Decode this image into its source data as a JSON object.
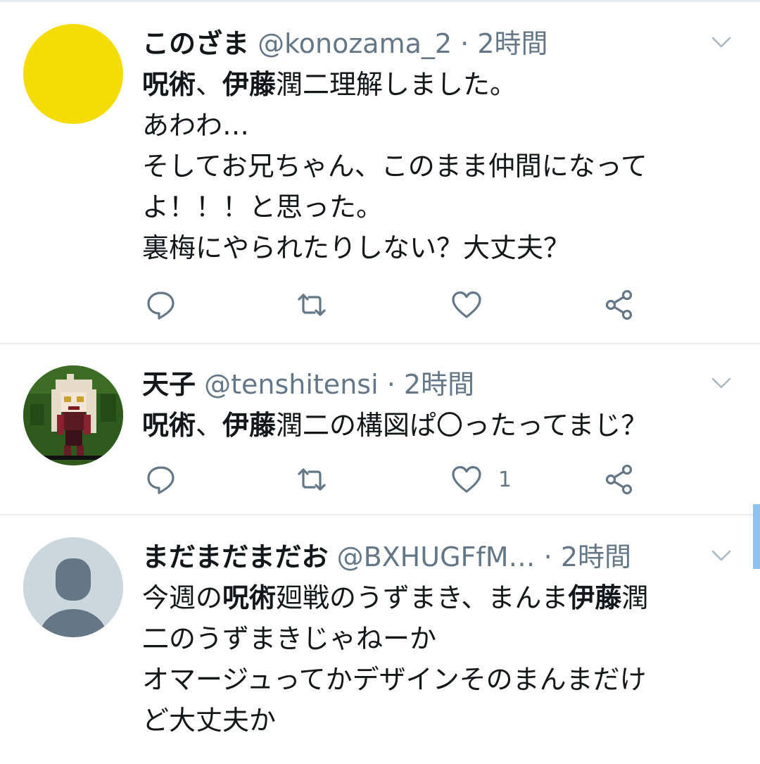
{
  "tweets": [
    {
      "user": {
        "name": "このざま",
        "handle": "@konozama_2"
      },
      "separator": "·",
      "time": "2時間",
      "lines": [
        [
          {
            "t": "呪術",
            "b": true
          },
          {
            "t": "、"
          },
          {
            "t": "伊藤",
            "b": true
          },
          {
            "t": "潤二理解しました。"
          }
        ],
        [
          {
            "t": "あわわ…"
          }
        ],
        [
          {
            "t": "そしてお兄ちゃん、このまま仲間になって"
          }
        ],
        [
          {
            "t": "よ！！！と思った。"
          }
        ],
        [
          {
            "t": "裏梅にやられたりしない？大丈夫？"
          }
        ]
      ],
      "like_count": ""
    },
    {
      "user": {
        "name": "天子",
        "handle": "@tenshitensi"
      },
      "separator": "·",
      "time": "2時間",
      "lines": [
        [
          {
            "t": "呪術",
            "b": true
          },
          {
            "t": "、"
          },
          {
            "t": "伊藤",
            "b": true
          },
          {
            "t": "潤二の構図ぱ〇ったってまじ？"
          }
        ]
      ],
      "like_count": "1"
    },
    {
      "user": {
        "name": "まだまだまだお",
        "handle": "@BXHUGFfM…"
      },
      "separator": "·",
      "time": "2時間",
      "lines": [
        [
          {
            "t": "今週の"
          },
          {
            "t": "呪術",
            "b": true
          },
          {
            "t": "廻戦のうずまき、まんま"
          },
          {
            "t": "伊藤",
            "b": true
          },
          {
            "t": "潤"
          }
        ],
        [
          {
            "t": "二のうずまきじゃねーか"
          }
        ],
        [
          {
            "t": "オマージュってかデザインそのまんまだけ"
          }
        ],
        [
          {
            "t": "ど大丈夫か"
          }
        ]
      ],
      "like_count": ""
    }
  ],
  "icons": {
    "reply": "reply-bubble-icon",
    "retweet": "retweet-arrows-icon",
    "like": "heart-icon",
    "share": "share-nodes-icon",
    "caret": "chevron-down-icon",
    "default_avatar": "default-person-avatar"
  },
  "colors": {
    "text": "#14171a",
    "secondary": "#657786",
    "divider": "#e6ecf0",
    "scrollbar": "#8ec3ef",
    "avatar_yellow": "#f4dc04",
    "avatar_default_bg": "#ccd6dd",
    "avatar_default_fg": "#657786"
  }
}
